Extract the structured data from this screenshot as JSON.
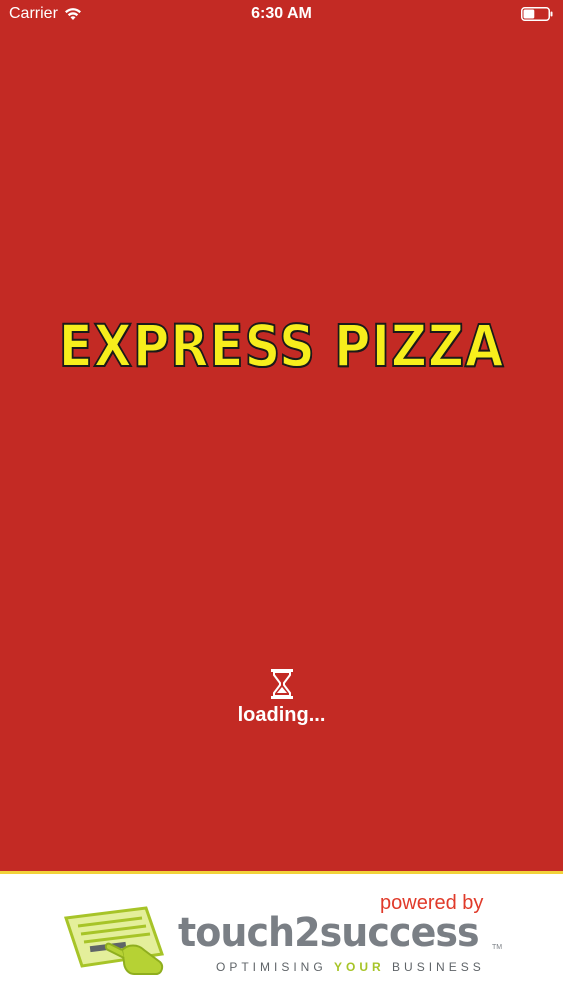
{
  "status_bar": {
    "carrier": "Carrier",
    "time": "6:30 AM",
    "battery_level": 0.45
  },
  "splash": {
    "title": "EXPRESS PIZZA",
    "loading_text": "loading..."
  },
  "footer": {
    "powered_by": "powered by",
    "brand": "touch2success",
    "tm": "TM",
    "tagline_part1": "OPTIMISING",
    "tagline_highlight": "YOUR",
    "tagline_part2": "BUSINESS"
  },
  "colors": {
    "background": "#c32a24",
    "title_fill": "#f7ee1c",
    "footer_accent": "#f2d23a",
    "powered_by": "#e03a2a",
    "brand_gray": "#7a7f85",
    "tagline_highlight": "#a7c428"
  },
  "icons": {
    "wifi": "wifi-icon",
    "battery": "battery-icon",
    "loading": "hourglass-icon",
    "logo": "touch2success-logo-icon"
  }
}
